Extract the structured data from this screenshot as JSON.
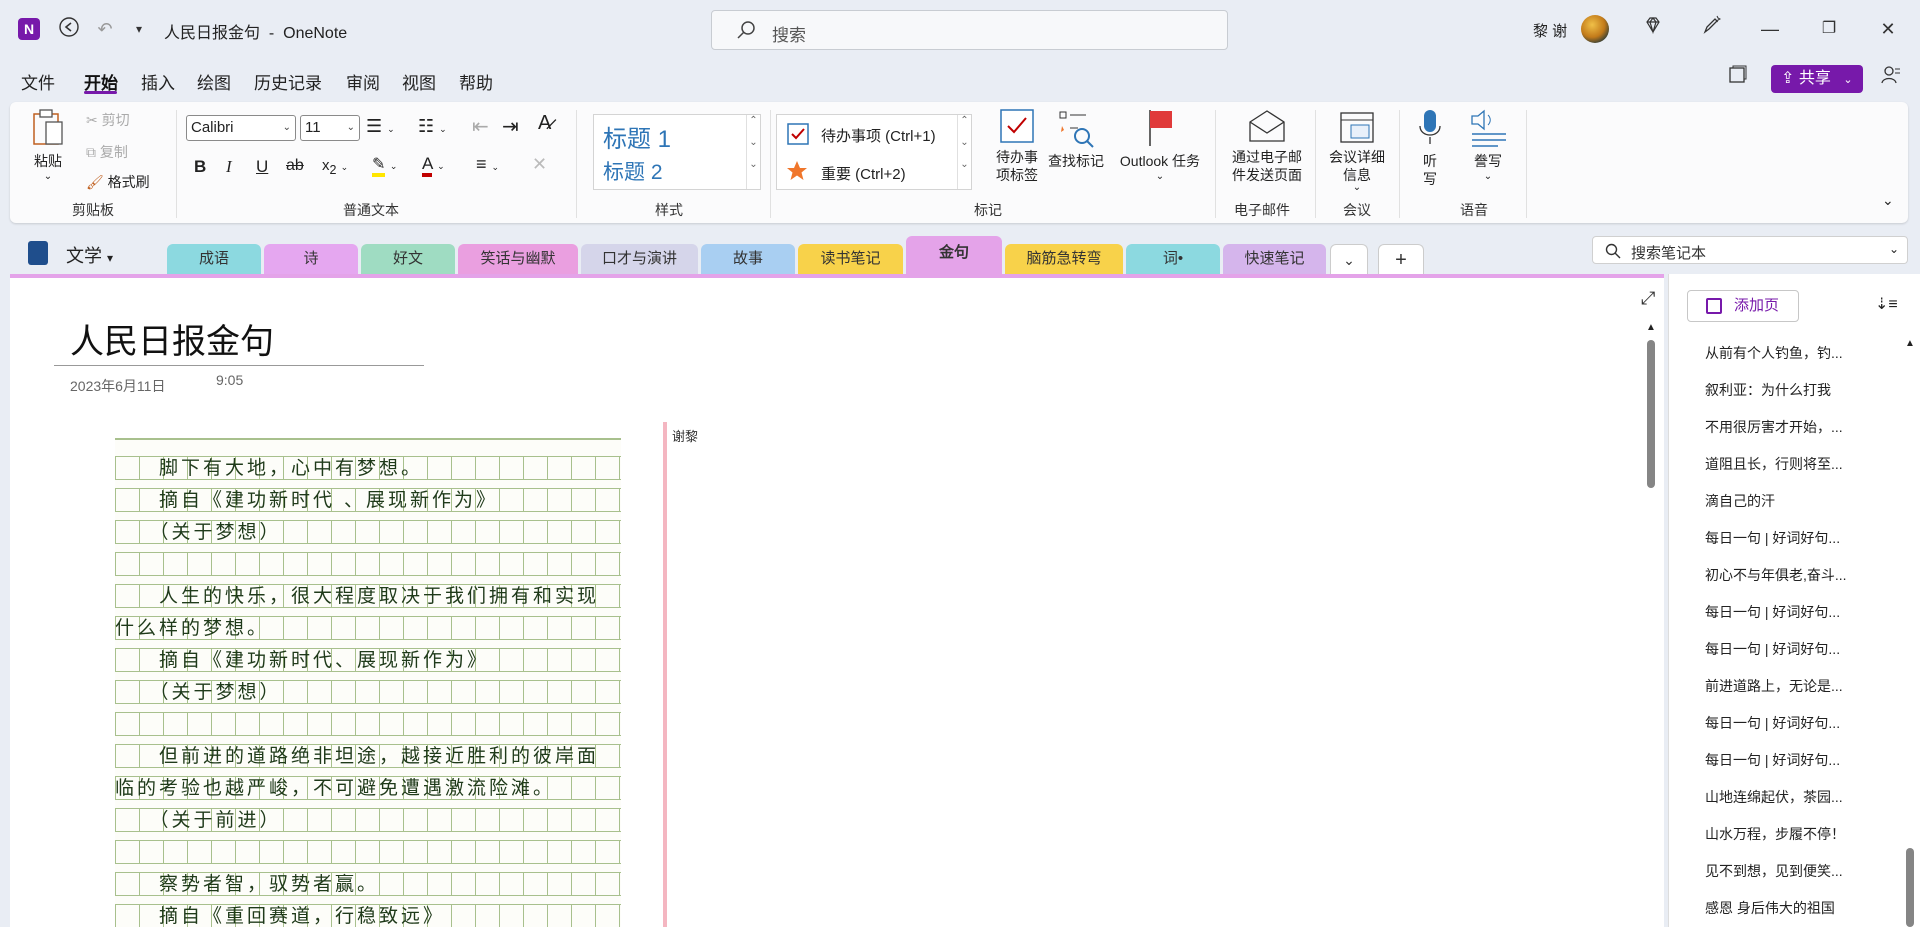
{
  "titlebar": {
    "doc_title": "人民日报金句",
    "separator": "-",
    "app_name": "OneNote",
    "search_placeholder": "搜索",
    "user_name": "黎 谢"
  },
  "menu": [
    "文件",
    "开始",
    "插入",
    "绘图",
    "历史记录",
    "审阅",
    "视图",
    "帮助"
  ],
  "share_label": "共享",
  "ribbon": {
    "clipboard": {
      "paste": "粘贴",
      "cut": "剪切",
      "copy": "复制",
      "format_painter": "格式刷",
      "label": "剪贴板"
    },
    "font": {
      "family": "Calibri",
      "size": "11",
      "label": "普通文本"
    },
    "styles": {
      "h1": "标题 1",
      "h2": "标题 2",
      "label": "样式"
    },
    "tags": {
      "todo": "待办事项 (Ctrl+1)",
      "important": "重要 (Ctrl+2)",
      "todo_tag": "待办事项标签",
      "find_tags": "查找标记",
      "outlook": "Outlook 任务",
      "label": "标记"
    },
    "email": {
      "send": "通过电子邮件发送页面",
      "label": "电子邮件"
    },
    "meeting": {
      "details": "会议详细信息",
      "label": "会议"
    },
    "voice": {
      "dictate": "听写",
      "read": "誊写",
      "label": "语音"
    }
  },
  "notebook": {
    "name": "文学",
    "search_placeholder": "搜索笔记本"
  },
  "sections": [
    {
      "name": "成语",
      "color": "#8cd9e0"
    },
    {
      "name": "诗",
      "color": "#e5a7f0"
    },
    {
      "name": "好文",
      "color": "#9fdcc2"
    },
    {
      "name": "笑话与幽默",
      "color": "#ea9fe0"
    },
    {
      "name": "口才与演讲",
      "color": "#d5d5ea"
    },
    {
      "name": "故事",
      "color": "#a9cff2"
    },
    {
      "name": "读书笔记",
      "color": "#f8d24a"
    },
    {
      "name": "金句",
      "color": "#e4a3e9"
    },
    {
      "name": "脑筋急转弯",
      "color": "#f8d24a"
    },
    {
      "name": "词•",
      "color": "#8cd9e0"
    },
    {
      "name": "快速笔记",
      "color": "#d5b5ec"
    }
  ],
  "page": {
    "title": "人民日报金句",
    "date": "2023年6月11日",
    "time": "9:05",
    "note_author": "谢黎",
    "handwriting": [
      "　　脚下有大地，心中有梦想。",
      "　　摘自《建功新时代 、展现新作为》",
      "　　（关于梦想）",
      "",
      "　　人生的快乐，很大程度取决于我们拥有和实现",
      "什么样的梦想。",
      "　　摘自《建功新时代、展现新作为》",
      "　　（关于梦想）",
      "",
      "　　但前进的道路绝非坦途，越接近胜利的彼岸面",
      "临的考验也越严峻，不可避免遭遇激流险滩。",
      "　　（关于前进）",
      "",
      "　　察势者智，驭势者赢。",
      "　　摘自《重回赛道，行稳致远》"
    ]
  },
  "page_list": {
    "add_label": "添加页",
    "items": [
      "从前有个人钓鱼，钓...",
      "叙利亚：为什么打我",
      "不用很厉害才开始，...",
      "道阻且长，行则将至...",
      "滴自己的汗",
      "每日一句 | 好词好句...",
      "初心不与年俱老,奋斗...",
      "每日一句 | 好词好句...",
      "每日一句 | 好词好句...",
      "前进道路上，无论是...",
      "每日一句 | 好词好句...",
      "每日一句 | 好词好句...",
      "山地连绵起伏，茶园...",
      "山水万程，步履不停！",
      "见不到想，见到便笑...",
      "感恩 身后伟大的祖国"
    ]
  }
}
